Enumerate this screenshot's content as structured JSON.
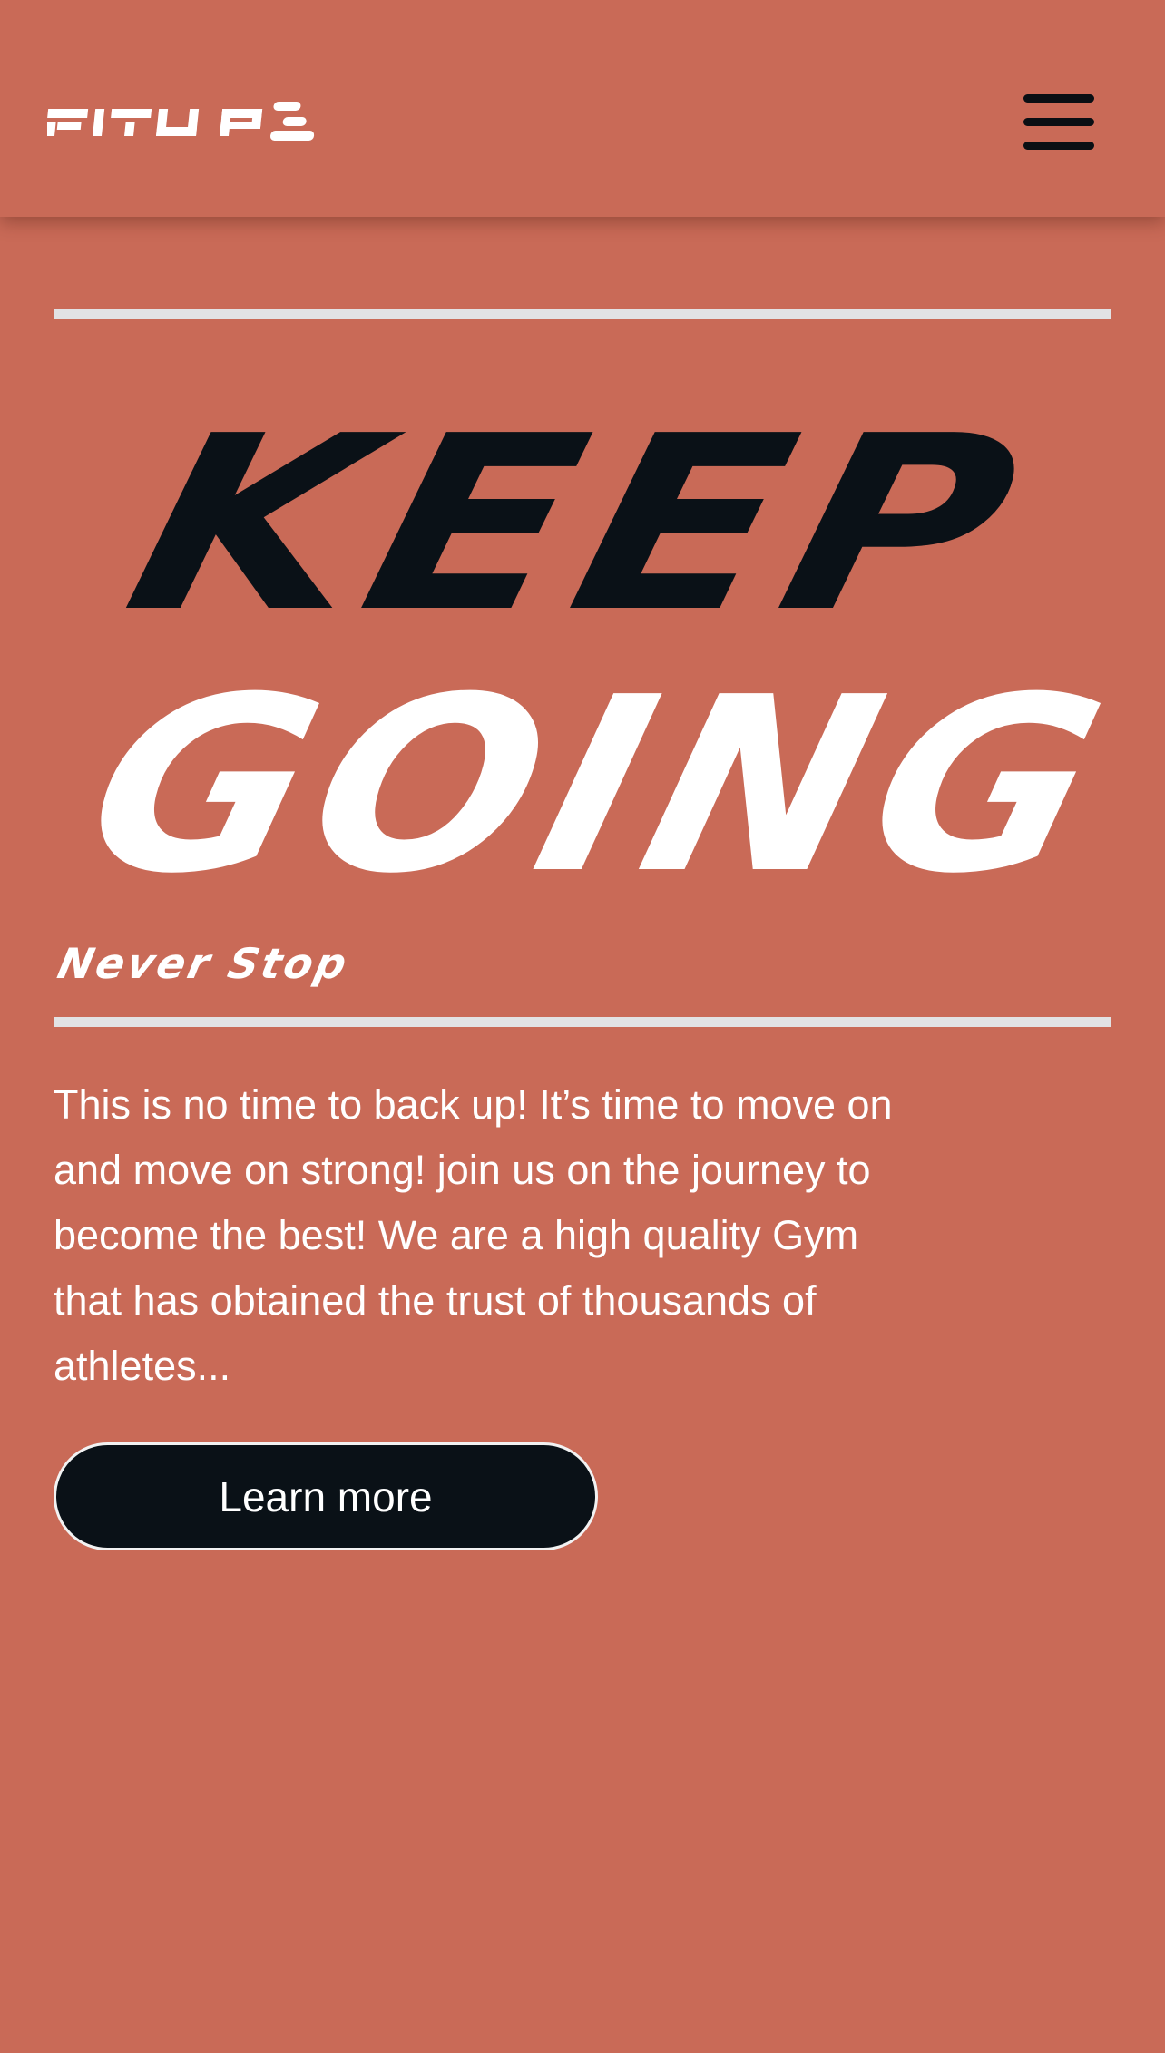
{
  "header": {
    "logo_text": "FITU PZ",
    "menu_icon": "hamburger-menu-icon"
  },
  "hero": {
    "headline_line1": "KEEP",
    "headline_line2": "GOING",
    "subheading": "Never Stop",
    "body": "This is no time to back up! It’s time to move on and move on strong! join us on the journey to become the best! We are a high quality Gym that has obtained the trust of thousands of athletes...",
    "cta_label": "Learn more"
  },
  "colors": {
    "background": "#c96a57",
    "headline_dark": "#0a1117",
    "headline_light": "#ffffff",
    "rule": "#e2e2e4",
    "button_bg": "#0a1117"
  }
}
